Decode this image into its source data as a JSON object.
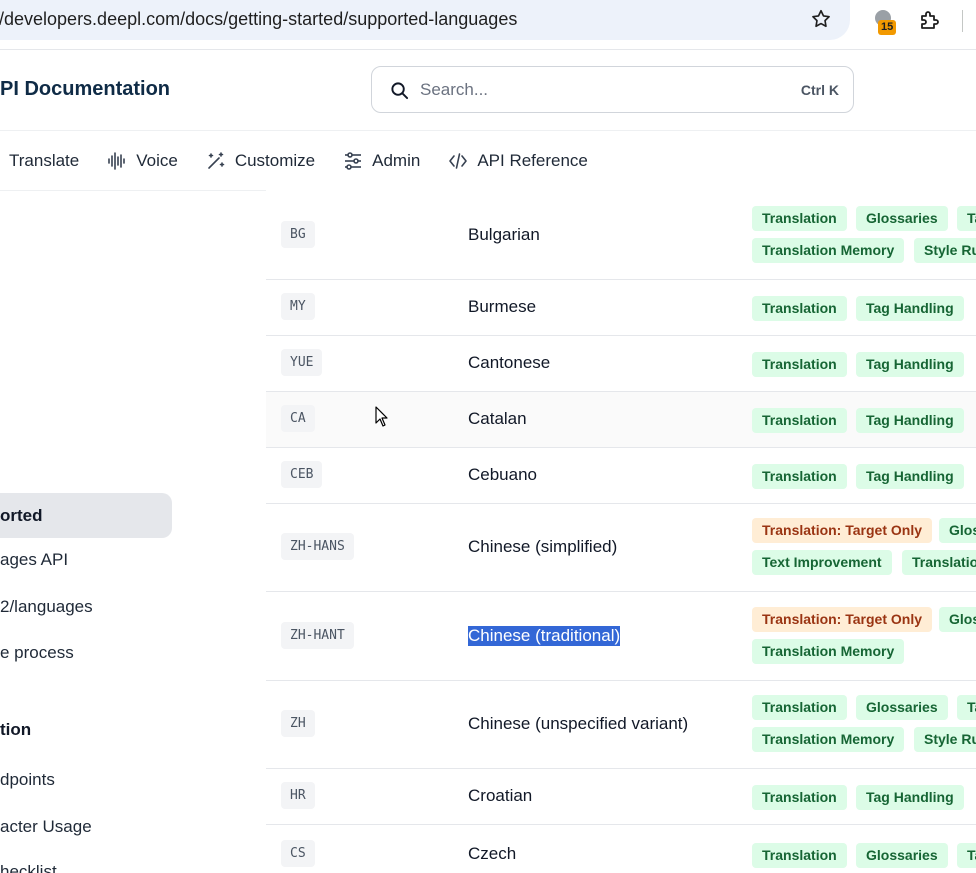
{
  "browser": {
    "url": "s://developers.deepl.com/docs/getting-started/supported-languages",
    "extension_badge": "15"
  },
  "header": {
    "title": "PI Documentation",
    "search_placeholder": "Search...",
    "search_shortcut": "Ctrl K"
  },
  "nav": {
    "tabs": [
      "Translate",
      "Voice",
      "Customize",
      "Admin",
      "API Reference"
    ]
  },
  "sidebar": {
    "items": [
      {
        "label": "orted",
        "active": true
      },
      {
        "label": "ages API"
      },
      {
        "label": "2/languages"
      },
      {
        "label": "e process"
      },
      {
        "label": "tion",
        "heading": true
      },
      {
        "label": "dpoints"
      },
      {
        "label": "acter Usage"
      },
      {
        "label": "hecklist"
      }
    ]
  },
  "table": {
    "rows": [
      {
        "code": "BG",
        "name": "Bulgarian",
        "badges": [
          [
            "Translation",
            "Glossaries",
            "Ta"
          ],
          [
            "Translation Memory",
            "Style Ru"
          ]
        ]
      },
      {
        "code": "MY",
        "name": "Burmese",
        "badges": [
          [
            "Translation",
            "Tag Handling"
          ]
        ]
      },
      {
        "code": "YUE",
        "name": "Cantonese",
        "badges": [
          [
            "Translation",
            "Tag Handling"
          ]
        ]
      },
      {
        "code": "CA",
        "name": "Catalan",
        "badges": [
          [
            "Translation",
            "Tag Handling"
          ]
        ]
      },
      {
        "code": "CEB",
        "name": "Cebuano",
        "badges": [
          [
            "Translation",
            "Tag Handling"
          ]
        ]
      },
      {
        "code": "ZH-HANS",
        "name": "Chinese (simplified)",
        "badges": [
          [
            "Translation: Target Only",
            "Glos"
          ],
          [
            "Text Improvement",
            "Translatio"
          ]
        ]
      },
      {
        "code": "ZH-HANT",
        "name": "Chinese (traditional)",
        "selected": true,
        "badges": [
          [
            "Translation: Target Only",
            "Glos"
          ],
          [
            "Translation Memory"
          ]
        ]
      },
      {
        "code": "ZH",
        "name": "Chinese (unspecified variant)",
        "badges": [
          [
            "Translation",
            "Glossaries",
            "Ta"
          ],
          [
            "Translation Memory",
            "Style Ru"
          ]
        ]
      },
      {
        "code": "HR",
        "name": "Croatian",
        "badges": [
          [
            "Translation",
            "Tag Handling"
          ]
        ]
      },
      {
        "code": "CS",
        "name": "Czech",
        "badges": [
          [
            "Translation",
            "Glossaries",
            "Ta"
          ]
        ]
      }
    ]
  },
  "colors": {
    "badge_green_bg": "#dcfce7",
    "badge_green_text": "#166534",
    "badge_orange_bg": "#ffedd5",
    "badge_orange_text": "#9a3412",
    "selection": "#3367d6"
  }
}
